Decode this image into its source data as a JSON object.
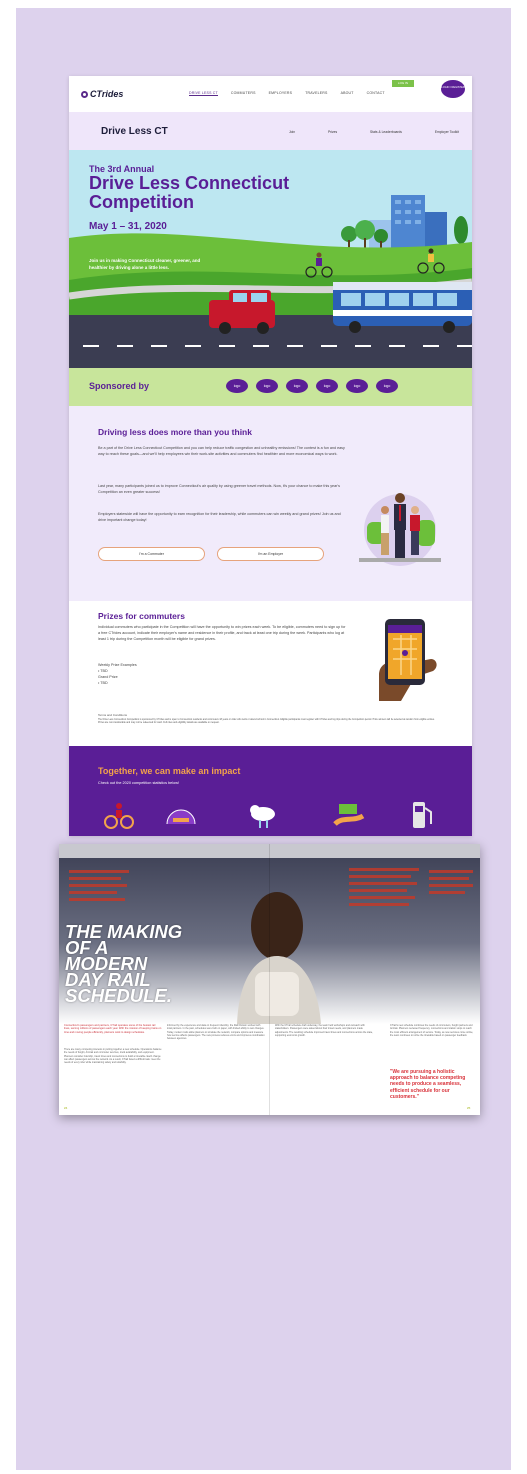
{
  "site": {
    "logo": "CTrides",
    "nav_links": [
      "DRIVE LESS CT",
      "COMMUTERS",
      "EMPLOYERS",
      "TRAVELERS",
      "ABOUT",
      "CONTACT"
    ],
    "nav_button": "LOG IN",
    "nav_bubble": "LOGIN / REGISTER",
    "subnav_title": "Drive Less CT",
    "subnav_links": [
      "Join",
      "Prizes",
      "Stats & Leaderboards",
      "Employer Toolkit"
    ],
    "hero": {
      "kicker": "The 3rd Annual",
      "headline": "Drive Less Connecticut Competition",
      "dates": "May 1 – 31, 2020",
      "blurb": "Join us in making Connecticut cleaner, greener, and healthier by driving alone a little less."
    },
    "sponsor": {
      "label": "Sponsored by",
      "logos": [
        "logo",
        "logo",
        "logo",
        "logo",
        "logo",
        "logo"
      ]
    },
    "driving": {
      "heading": "Driving less does more than you think",
      "p1": "Be a part of the Drive Less Connecticut Competition and you can help reduce traffic congestion and unhealthy emissions! The contest is a fun and easy way to reach these goals—and we'll help employees win their work-site activities and commuters find healthier and more economical ways to work.",
      "p2": "Last year, many participants joined us to improve Connecticut's air quality by using greener travel methods. Now, it's your chance to make this year's Competition an even greater success!",
      "p3": "Employers statewide will have the opportunity to earn recognition for their leadership, while commuters can win weekly and grand prizes! Join us and drive important change today!",
      "button_commuter": "I'm a Commuter",
      "button_employer": "I'm an Employer"
    },
    "prizes": {
      "heading": "Prizes for commuters",
      "intro": "Individual commuters who participate in the Competition will have the opportunity to win prizes each week. To be eligible, commuters need to sign up for a free CTrides account, indicate their employer's name and residence in their profile, and track at least one trip during the week. Participants who log at least 1 trip during the Competition month will be eligible for grand prizes.",
      "weekly_label": "Weekly Prize Examples",
      "weekly_item": "• TBD",
      "grand_label": "Grand Prize",
      "grand_item": "• TBD",
      "fine_title": "Terms and Conditions",
      "fine_text": "The Drive Less Connecticut Competition is sponsored by CTrides and is open to Connecticut residents and commuters 18 years or older who work or attend school in Connecticut. Eligible participants must register with CTrides and log trips during the Competition period. Prize winners will be selected at random from eligible entries. Prizes are non-transferable and may not be redeemed for cash. Full rules and eligibility details are available on request."
    },
    "impact": {
      "heading": "Together, we can make an impact",
      "sub": "Check out the 2020 competition statistics below!"
    }
  },
  "magazine": {
    "title": "THE MAKING OF A MODERN DAY RAIL SCHEDULE.",
    "lead": "Connecticut's passengers and partners, CTrail operates some of the busiest rail lines, serving millions of passengers each year. With the mission of keeping trains on time and moving people efficiently, planners work to design schedules.",
    "col1": "There are many competing interests in putting together a new schedule. Operations balance the needs of freight, Amtrak and commuter services, track availability, and equipment. Planners consider ridership, travel times and connections to build a timetable. Each change can affect passengers across the network. As a result, CTrail faced a difficult task: meet the needs of every rider while maintaining safety and reliability.",
    "col2": "Informed by the experience and data on frequent ridership, the Rail Division worked with local partners. In the past, schedules were built on paper, with limited ability to test changes. Today, modern tools allow planners to simulate the network, compare options and measure how service affects passengers. The new process reduces errors and improves coordination between agencies.",
    "col3": "With the CTrail schedule draft underway, the team held workshops and outreach with stakeholders. Passengers were asked about their travel needs, and planners made adjustments. The resulting schedule improved travel times and connections across the state, supporting economic growth.",
    "col4": "CTrail's new schedule combines the needs of commuters, freight partners and Amtrak. Planners reviewed frequency, connections and station stops to reach the most efficient arrangement of service. Today, as new services come online, the team continues to refine the timetable based on passenger feedback.",
    "quote": "\"We are pursuing a holistic approach to balance competing needs to produce a seamless, efficient schedule for our customers.\"",
    "page_left": "24",
    "page_right": "25"
  }
}
